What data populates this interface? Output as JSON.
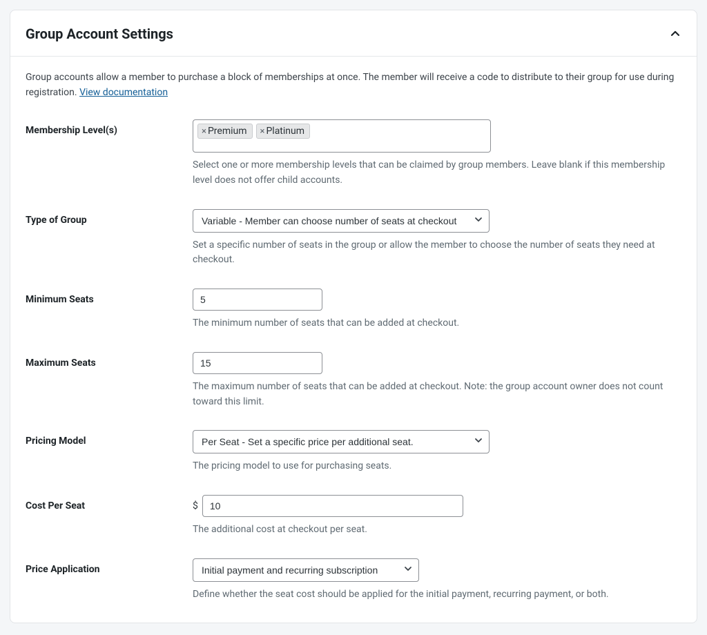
{
  "title": "Group Account Settings",
  "description_text": "Group accounts allow a member to purchase a block of memberships at once. The member will receive a code to distribute to their group for use during registration. ",
  "description_link": "View documentation",
  "fields": {
    "membership_levels": {
      "label": "Membership Level(s)",
      "tags": [
        "Premium",
        "Platinum"
      ],
      "help": "Select one or more membership levels that can be claimed by group members. Leave blank if this membership level does not offer child accounts."
    },
    "type_of_group": {
      "label": "Type of Group",
      "selected": "Variable - Member can choose number of seats at checkout",
      "help": "Set a specific number of seats in the group or allow the member to choose the number of seats they need at checkout."
    },
    "min_seats": {
      "label": "Minimum Seats",
      "value": "5",
      "help": "The minimum number of seats that can be added at checkout."
    },
    "max_seats": {
      "label": "Maximum Seats",
      "value": "15",
      "help": "The maximum number of seats that can be added at checkout. Note: the group account owner does not count toward this limit."
    },
    "pricing_model": {
      "label": "Pricing Model",
      "selected": "Per Seat - Set a specific price per additional seat.",
      "help": "The pricing model to use for purchasing seats."
    },
    "cost_per_seat": {
      "label": "Cost Per Seat",
      "currency": "$",
      "value": "10",
      "help": "The additional cost at checkout per seat."
    },
    "price_application": {
      "label": "Price Application",
      "selected": "Initial payment and recurring subscription",
      "help": "Define whether the seat cost should be applied for the initial payment, recurring payment, or both."
    }
  }
}
